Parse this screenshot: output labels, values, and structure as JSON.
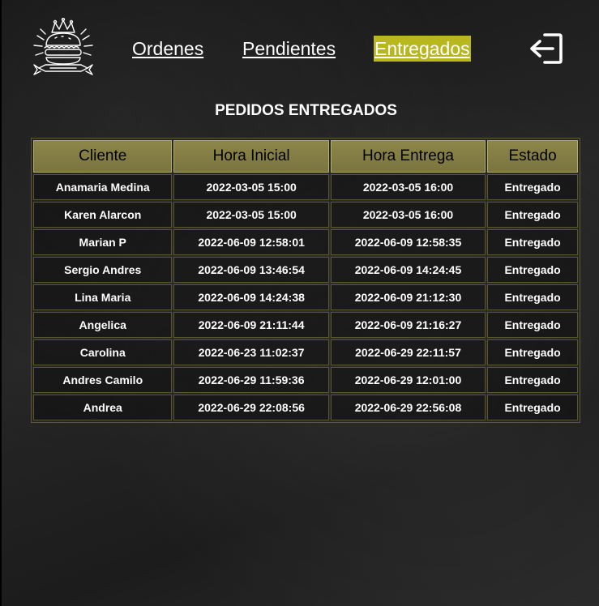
{
  "header": {
    "logo_icon": "burger-crown-logo-icon",
    "nav": [
      {
        "label": "Ordenes",
        "active": false
      },
      {
        "label": "Pendientes",
        "active": false
      },
      {
        "label": "Entregados",
        "active": true
      }
    ],
    "logout_icon": "logout-icon",
    "active_color": "#b8b81e"
  },
  "main": {
    "title": "PEDIDOS ENTREGADOS",
    "table": {
      "headers": [
        "Cliente",
        "Hora Inicial",
        "Hora Entrega",
        "Estado"
      ],
      "rows": [
        [
          "Anamaria Medina",
          "2022-03-05 15:00",
          "2022-03-05 16:00",
          "Entregado"
        ],
        [
          "Karen Alarcon",
          "2022-03-05 15:00",
          "2022-03-05 16:00",
          "Entregado"
        ],
        [
          "Marian P",
          "2022-06-09 12:58:01",
          "2022-06-09 12:58:35",
          "Entregado"
        ],
        [
          "Sergio Andres",
          "2022-06-09 13:46:54",
          "2022-06-09 14:24:45",
          "Entregado"
        ],
        [
          "Lina Maria",
          "2022-06-09 14:24:38",
          "2022-06-09 21:12:30",
          "Entregado"
        ],
        [
          "Angelica",
          "2022-06-09 21:11:44",
          "2022-06-09 21:16:27",
          "Entregado"
        ],
        [
          "Carolina",
          "2022-06-23 11:02:37",
          "2022-06-29 22:11:57",
          "Entregado"
        ],
        [
          "Andres Camilo",
          "2022-06-29 11:59:36",
          "2022-06-29 12:01:00",
          "Entregado"
        ],
        [
          "Andrea",
          "2022-06-29 22:08:56",
          "2022-06-29 22:56:08",
          "Entregado"
        ]
      ]
    }
  }
}
